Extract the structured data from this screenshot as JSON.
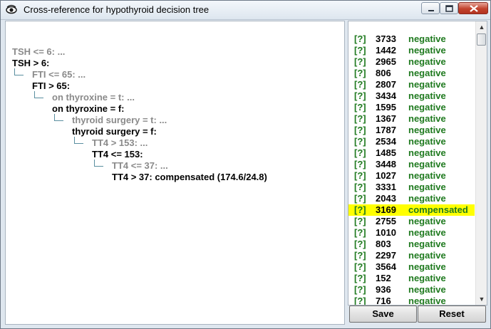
{
  "window": {
    "title": "Cross-reference for hypothyroid decision tree",
    "icon": "eye-icon",
    "controls": [
      "minimize-icon",
      "maximize-icon",
      "close-icon"
    ]
  },
  "tree": [
    {
      "text": "TSH <= 6: ...",
      "state": "dim"
    },
    {
      "text": "TSH > 6:",
      "state": "active"
    },
    {
      "text": "FTI <= 65: ...",
      "state": "dim",
      "connector": true
    },
    {
      "text": "FTI > 65:",
      "state": "active"
    },
    {
      "text": "on thyroxine = t: ...",
      "state": "dim",
      "connector": true
    },
    {
      "text": "on thyroxine = f:",
      "state": "active"
    },
    {
      "text": "thyroid surgery = t: ...",
      "state": "dim",
      "connector": true
    },
    {
      "text": "thyroid surgery = f:",
      "state": "active"
    },
    {
      "text": "TT4 > 153: ...",
      "state": "dim",
      "connector": true
    },
    {
      "text": "TT4 <= 153:",
      "state": "active"
    },
    {
      "text": "TT4 <= 37: ...",
      "state": "dim",
      "connector": true
    },
    {
      "text": "TT4 > 37: compensated (174.6/24.8)",
      "state": "active"
    }
  ],
  "cases": [
    {
      "tag": "[?]",
      "id": "3733",
      "class": "negative"
    },
    {
      "tag": "[?]",
      "id": "1442",
      "class": "negative"
    },
    {
      "tag": "[?]",
      "id": "2965",
      "class": "negative"
    },
    {
      "tag": "[?]",
      "id": "806",
      "class": "negative"
    },
    {
      "tag": "[?]",
      "id": "2807",
      "class": "negative"
    },
    {
      "tag": "[?]",
      "id": "3434",
      "class": "negative"
    },
    {
      "tag": "[?]",
      "id": "1595",
      "class": "negative"
    },
    {
      "tag": "[?]",
      "id": "1367",
      "class": "negative"
    },
    {
      "tag": "[?]",
      "id": "1787",
      "class": "negative"
    },
    {
      "tag": "[?]",
      "id": "2534",
      "class": "negative"
    },
    {
      "tag": "[?]",
      "id": "1485",
      "class": "negative"
    },
    {
      "tag": "[?]",
      "id": "3448",
      "class": "negative"
    },
    {
      "tag": "[?]",
      "id": "1027",
      "class": "negative"
    },
    {
      "tag": "[?]",
      "id": "3331",
      "class": "negative"
    },
    {
      "tag": "[?]",
      "id": "2043",
      "class": "negative"
    },
    {
      "tag": "[?]",
      "id": "3169",
      "class": "compensated",
      "selected": true
    },
    {
      "tag": "[?]",
      "id": "2755",
      "class": "negative"
    },
    {
      "tag": "[?]",
      "id": "1010",
      "class": "negative"
    },
    {
      "tag": "[?]",
      "id": "803",
      "class": "negative"
    },
    {
      "tag": "[?]",
      "id": "2297",
      "class": "negative"
    },
    {
      "tag": "[?]",
      "id": "3564",
      "class": "negative"
    },
    {
      "tag": "[?]",
      "id": "152",
      "class": "negative"
    },
    {
      "tag": "[?]",
      "id": "936",
      "class": "negative"
    },
    {
      "tag": "[?]",
      "id": "716",
      "class": "negative"
    }
  ],
  "scrollbar": {
    "up": "scroll-up-icon",
    "down": "scroll-down-icon"
  },
  "buttons": {
    "save": "Save",
    "reset": "Reset"
  },
  "colors": {
    "highlight": "#ffff00",
    "class_text": "#1f7a1f",
    "dim_text": "#8a8a8a"
  }
}
